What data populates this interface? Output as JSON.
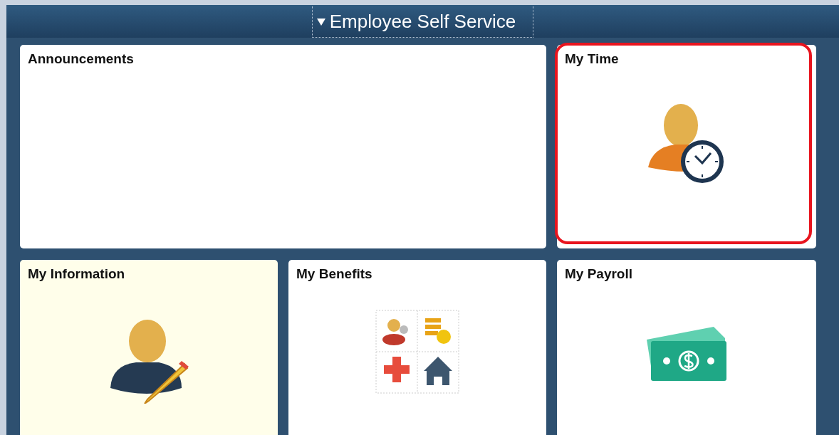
{
  "header": {
    "title": "Employee Self Service"
  },
  "tiles": [
    {
      "title": "Announcements",
      "kind": "blank",
      "wide": true,
      "highlighted": false,
      "outlined": false
    },
    {
      "title": "My Time",
      "kind": "time",
      "wide": false,
      "highlighted": false,
      "outlined": true
    },
    {
      "title": "My Information",
      "kind": "info",
      "wide": false,
      "highlighted": true,
      "outlined": false
    },
    {
      "title": "My Benefits",
      "kind": "benefits",
      "wide": false,
      "highlighted": false,
      "outlined": false
    },
    {
      "title": "My Payroll",
      "kind": "payroll",
      "wide": false,
      "highlighted": false,
      "outlined": false
    }
  ]
}
